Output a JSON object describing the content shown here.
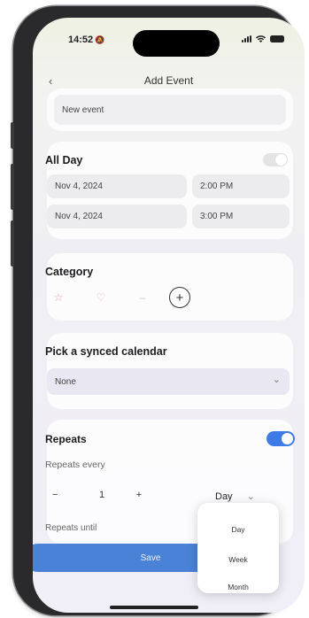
{
  "status_bar": {
    "time": "14:52",
    "bell_icon": "bell-off-icon"
  },
  "nav": {
    "back_icon": "chevron-left-icon",
    "back_glyph": "‹",
    "title": "Add Event"
  },
  "title_field": {
    "value": "New event"
  },
  "all_day": {
    "label": "All Day",
    "toggle_on": false,
    "start_date": "Nov 4, 2024",
    "start_time": "2:00 PM",
    "end_date": "Nov 4, 2024",
    "end_time": "3:00 PM"
  },
  "category": {
    "label": "Category",
    "add_glyph": "+",
    "swatches": [
      {
        "icon": "star-icon",
        "glyph": "☆",
        "color": "#f0a0a0"
      },
      {
        "icon": "heart-icon",
        "glyph": "♡",
        "color": "#f4b4b4"
      },
      {
        "icon": "dash-icon",
        "glyph": "–",
        "color": "#c8c8c8"
      }
    ]
  },
  "calendar": {
    "label": "Pick a synced calendar",
    "selected": "None",
    "chevron_glyph": "⌄"
  },
  "repeats": {
    "label": "Repeats",
    "toggle_on": true,
    "every_label": "Repeats every",
    "minus": "−",
    "count": "1",
    "plus": "+",
    "unit": "Day",
    "unit_chevron": "⌄",
    "until_label": "Repeats until"
  },
  "unit_menu": {
    "options": [
      "Day",
      "Week",
      "Month"
    ]
  },
  "save_button": {
    "label": "Save"
  },
  "colors": {
    "accent": "#3e7be6",
    "save": "#4a82d8"
  }
}
